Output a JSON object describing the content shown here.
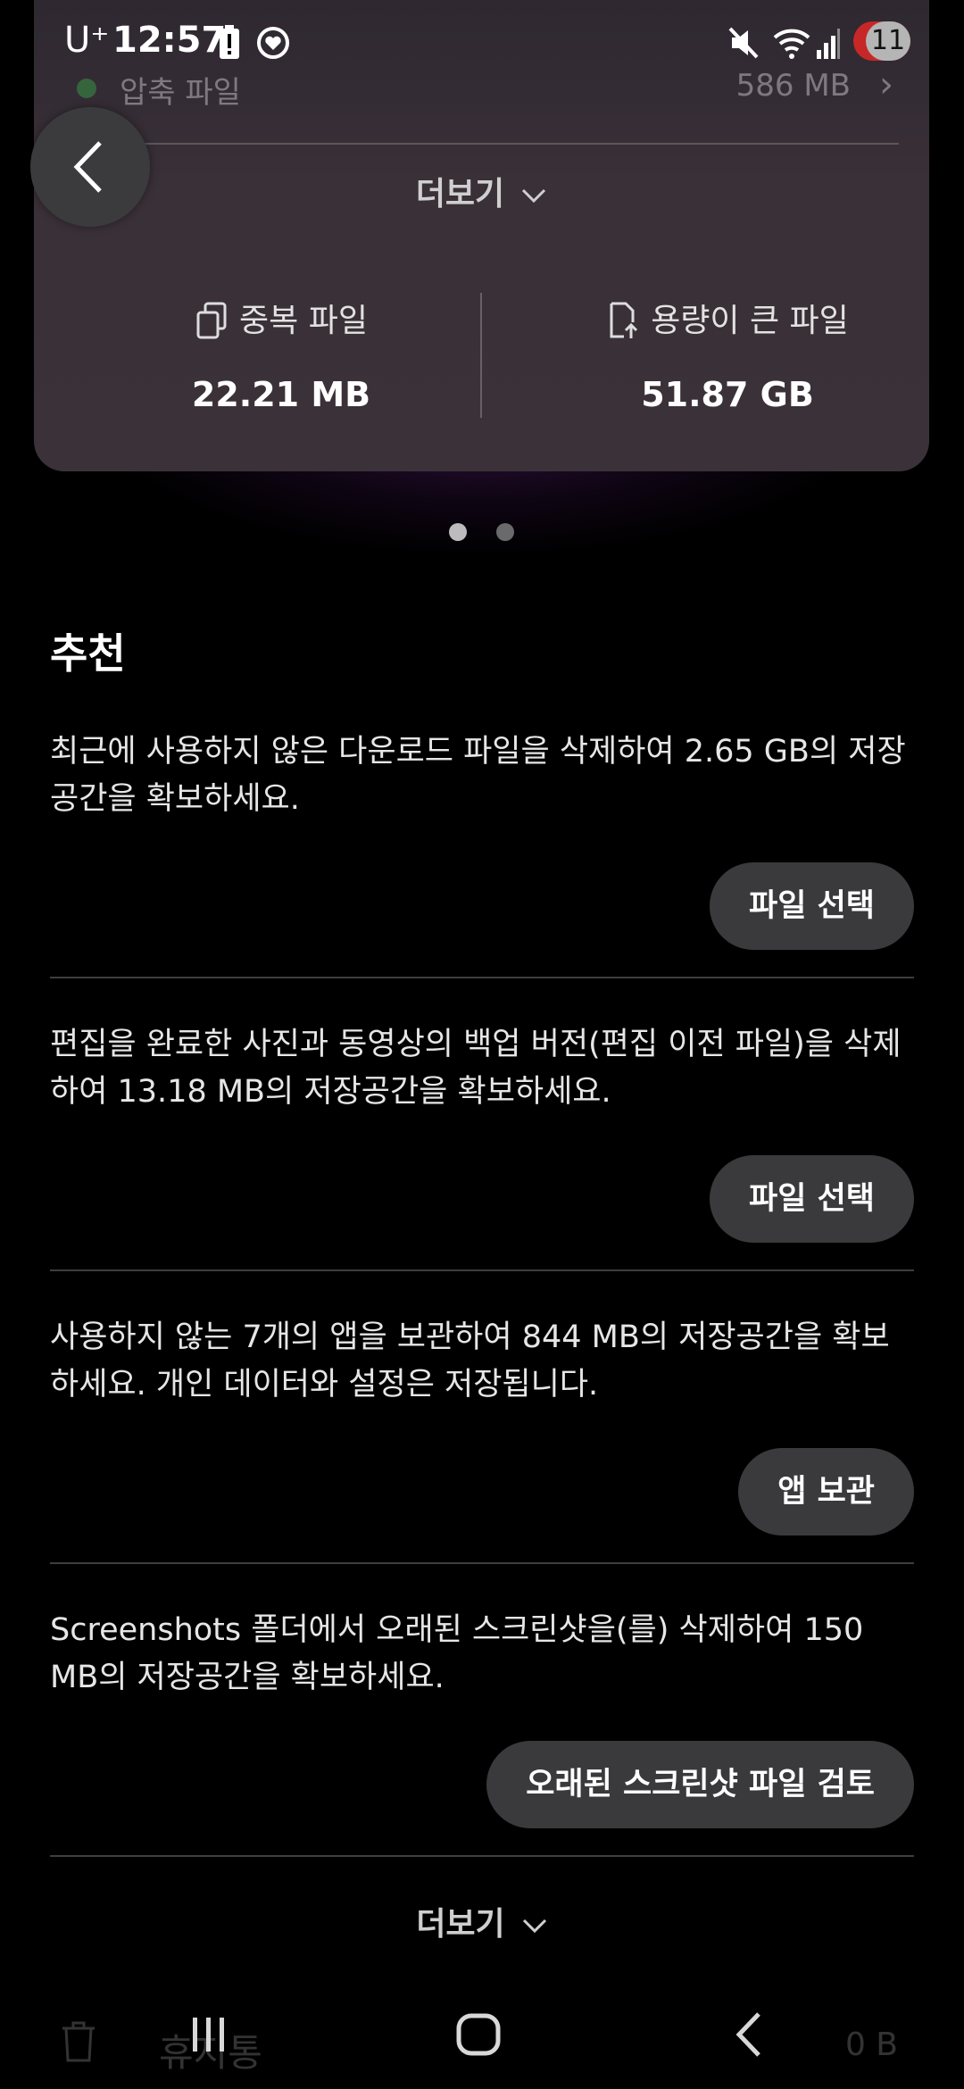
{
  "status_bar": {
    "carrier": "U⁺",
    "time": "12:57",
    "notification_count": "11"
  },
  "storage_card": {
    "compressed_files": {
      "label": "압축 파일",
      "size": "586 MB"
    },
    "more_label": "더보기",
    "stats": [
      {
        "label": "중복 파일",
        "value": "22.21 MB"
      },
      {
        "label": "용량이 큰 파일",
        "value": "51.87 GB"
      }
    ]
  },
  "recommendations": {
    "title": "추천",
    "items": [
      {
        "text": "최근에 사용하지 않은 다운로드 파일을 삭제하여 2.65 GB의 저장공간을 확보하세요.",
        "button": "파일 선택"
      },
      {
        "text": "편집을 완료한 사진과 동영상의 백업 버전(편집 이전 파일)을 삭제하여 13.18 MB의 저장공간을 확보하세요.",
        "button": "파일 선택"
      },
      {
        "text": "사용하지 않는 7개의 앱을 보관하여 844 MB의 저장공간을 확보하세요. 개인 데이터와 설정은 저장됩니다.",
        "button": "앱 보관"
      },
      {
        "text": "Screenshots 폴더에서 오래된 스크린샷을(를) 삭제하여 150 MB의 저장공간을 확보하세요.",
        "button": "오래된 스크린샷 파일 검토"
      }
    ],
    "more_label": "더보기"
  },
  "trash_row": {
    "label": "휴지통",
    "size": "0 B"
  },
  "colors": {
    "background": "#000000",
    "card": "#3a3038",
    "button": "#3a3a3c",
    "dot_active": "#bcbcbc"
  }
}
